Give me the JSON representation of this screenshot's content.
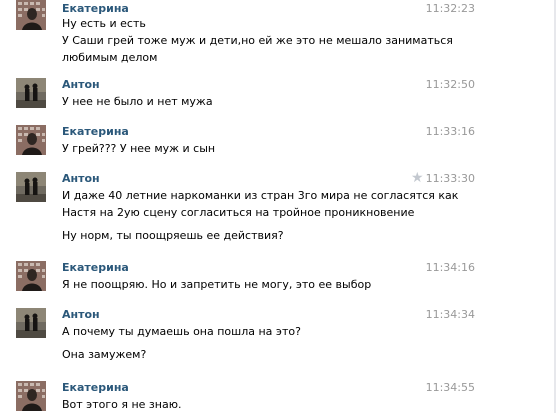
{
  "messages": [
    {
      "author": "Екатерина",
      "time": "11:32:23",
      "avatar": "avatar-ekaterina",
      "lines": [
        "Ну есть и есть",
        "У Саши грей тоже муж и дети,но ей же это не мешало заниматься",
        "любимым делом"
      ]
    },
    {
      "author": "Антон",
      "time": "11:32:50",
      "avatar": "avatar-anton",
      "lines": [
        "У нее не было и нет мужа"
      ]
    },
    {
      "author": "Екатерина",
      "time": "11:33:16",
      "avatar": "avatar-ekaterina",
      "lines": [
        "У грей??? У нее муж и сын"
      ]
    },
    {
      "author": "Антон",
      "time": "11:33:30",
      "avatar": "avatar-anton",
      "starred": true,
      "lines": [
        "И даже 40 летние наркоманки из стран 3го мира не согласятся как",
        "Настя на 2ую сцену согласиться на тройное проникновение",
        "",
        "Ну норм, ты поощряешь ее действия?"
      ]
    },
    {
      "author": "Екатерина",
      "time": "11:34:16",
      "avatar": "avatar-ekaterina",
      "lines": [
        "Я не поощряю. Но и запретить не могу, это ее выбор"
      ]
    },
    {
      "author": "Антон",
      "time": "11:34:34",
      "avatar": "avatar-anton",
      "lines": [
        "А почему ты думаешь она пошла на это?",
        "",
        "Она замужем?"
      ]
    },
    {
      "author": "Екатерина",
      "time": "11:34:55",
      "avatar": "avatar-ekaterina",
      "lines": [
        "Вот этого я не знаю."
      ]
    }
  ],
  "star_icon": "star-icon",
  "colors": {
    "author": "#2b587a",
    "time": "#999999",
    "star": "#c3c8cf"
  }
}
